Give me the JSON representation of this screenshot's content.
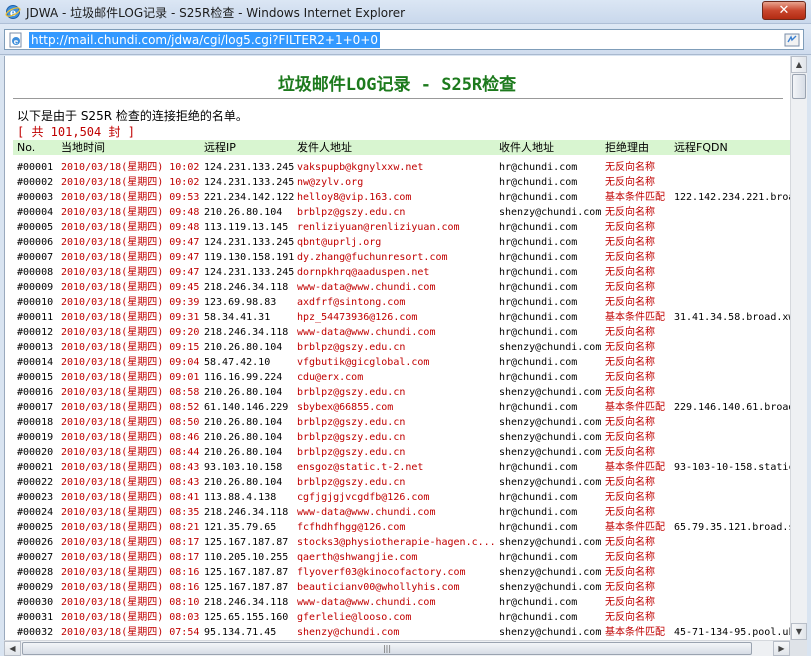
{
  "window": {
    "title": "JDWA - 垃圾邮件LOG记录 - S25R检查 - Windows Internet Explorer",
    "close_label": "✕"
  },
  "address": {
    "url": "http://mail.chundi.com/jdwa/cgi/log5.cgi?FILTER2+1+0+0"
  },
  "page": {
    "title": "垃圾邮件LOG记录 - S25R检查",
    "intro": "以下是由于 S25R 检查的连接拒绝的名单。",
    "total": "[ 共 101,504 封 ]"
  },
  "table": {
    "headers": {
      "no": "No.",
      "time": "当地时间",
      "ip": "远程IP",
      "from": "发件人地址",
      "to": "收件人地址",
      "reason": "拒绝理由",
      "fqdn": "远程FQDN"
    },
    "rows": [
      {
        "no": "#00001",
        "time": "2010/03/18(星期四) 10:02",
        "ip": "124.231.133.245",
        "from": "vakspupb@kgnylxxw.net",
        "to": "hr@chundi.com",
        "reason": "无反向名称",
        "fqdn": ""
      },
      {
        "no": "#00002",
        "time": "2010/03/18(星期四) 10:02",
        "ip": "124.231.133.245",
        "from": "nw@zylv.org",
        "to": "hr@chundi.com",
        "reason": "无反向名称",
        "fqdn": ""
      },
      {
        "no": "#00003",
        "time": "2010/03/18(星期四) 09:53",
        "ip": "221.234.142.122",
        "from": "helloy8@vip.163.com",
        "to": "hr@chundi.com",
        "reason": "基本条件匹配",
        "fqdn": "122.142.234.221.broa"
      },
      {
        "no": "#00004",
        "time": "2010/03/18(星期四) 09:48",
        "ip": "210.26.80.104",
        "from": "brblpz@gszy.edu.cn",
        "to": "shenzy@chundi.com",
        "reason": "无反向名称",
        "fqdn": ""
      },
      {
        "no": "#00005",
        "time": "2010/03/18(星期四) 09:48",
        "ip": "113.119.13.145",
        "from": "renliziyuan@renliziyuan.com",
        "to": "hr@chundi.com",
        "reason": "无反向名称",
        "fqdn": ""
      },
      {
        "no": "#00006",
        "time": "2010/03/18(星期四) 09:47",
        "ip": "124.231.133.245",
        "from": "qbnt@uprlj.org",
        "to": "hr@chundi.com",
        "reason": "无反向名称",
        "fqdn": ""
      },
      {
        "no": "#00007",
        "time": "2010/03/18(星期四) 09:47",
        "ip": "119.130.158.191",
        "from": "dy.zhang@fuchunresort.com",
        "to": "hr@chundi.com",
        "reason": "无反向名称",
        "fqdn": ""
      },
      {
        "no": "#00008",
        "time": "2010/03/18(星期四) 09:47",
        "ip": "124.231.133.245",
        "from": "dornpkhrq@aaduspen.net",
        "to": "hr@chundi.com",
        "reason": "无反向名称",
        "fqdn": ""
      },
      {
        "no": "#00009",
        "time": "2010/03/18(星期四) 09:45",
        "ip": "218.246.34.118",
        "from": "www-data@www.chundi.com",
        "to": "hr@chundi.com",
        "reason": "无反向名称",
        "fqdn": ""
      },
      {
        "no": "#00010",
        "time": "2010/03/18(星期四) 09:39",
        "ip": "123.69.98.83",
        "from": "axdfrf@sintong.com",
        "to": "hr@chundi.com",
        "reason": "无反向名称",
        "fqdn": ""
      },
      {
        "no": "#00011",
        "time": "2010/03/18(星期四) 09:31",
        "ip": "58.34.41.31",
        "from": "hpz_54473936@126.com",
        "to": "hr@chundi.com",
        "reason": "基本条件匹配",
        "fqdn": "31.41.34.58.broad.xw"
      },
      {
        "no": "#00012",
        "time": "2010/03/18(星期四) 09:20",
        "ip": "218.246.34.118",
        "from": "www-data@www.chundi.com",
        "to": "hr@chundi.com",
        "reason": "无反向名称",
        "fqdn": ""
      },
      {
        "no": "#00013",
        "time": "2010/03/18(星期四) 09:15",
        "ip": "210.26.80.104",
        "from": "brblpz@gszy.edu.cn",
        "to": "shenzy@chundi.com",
        "reason": "无反向名称",
        "fqdn": ""
      },
      {
        "no": "#00014",
        "time": "2010/03/18(星期四) 09:04",
        "ip": "58.47.42.10",
        "from": "vfgbutik@gicglobal.com",
        "to": "hr@chundi.com",
        "reason": "无反向名称",
        "fqdn": ""
      },
      {
        "no": "#00015",
        "time": "2010/03/18(星期四) 09:01",
        "ip": "116.16.99.224",
        "from": "cdu@erx.com",
        "to": "hr@chundi.com",
        "reason": "无反向名称",
        "fqdn": ""
      },
      {
        "no": "#00016",
        "time": "2010/03/18(星期四) 08:58",
        "ip": "210.26.80.104",
        "from": "brblpz@gszy.edu.cn",
        "to": "shenzy@chundi.com",
        "reason": "无反向名称",
        "fqdn": ""
      },
      {
        "no": "#00017",
        "time": "2010/03/18(星期四) 08:52",
        "ip": "61.140.146.229",
        "from": "sbybex@66855.com",
        "to": "hr@chundi.com",
        "reason": "基本条件匹配",
        "fqdn": "229.146.140.61.broad"
      },
      {
        "no": "#00018",
        "time": "2010/03/18(星期四) 08:50",
        "ip": "210.26.80.104",
        "from": "brblpz@gszy.edu.cn",
        "to": "shenzy@chundi.com",
        "reason": "无反向名称",
        "fqdn": ""
      },
      {
        "no": "#00019",
        "time": "2010/03/18(星期四) 08:46",
        "ip": "210.26.80.104",
        "from": "brblpz@gszy.edu.cn",
        "to": "shenzy@chundi.com",
        "reason": "无反向名称",
        "fqdn": ""
      },
      {
        "no": "#00020",
        "time": "2010/03/18(星期四) 08:44",
        "ip": "210.26.80.104",
        "from": "brblpz@gszy.edu.cn",
        "to": "shenzy@chundi.com",
        "reason": "无反向名称",
        "fqdn": ""
      },
      {
        "no": "#00021",
        "time": "2010/03/18(星期四) 08:43",
        "ip": "93.103.10.158",
        "from": "ensgoz@static.t-2.net",
        "to": "hr@chundi.com",
        "reason": "基本条件匹配",
        "fqdn": "93-103-10-158.static"
      },
      {
        "no": "#00022",
        "time": "2010/03/18(星期四) 08:43",
        "ip": "210.26.80.104",
        "from": "brblpz@gszy.edu.cn",
        "to": "shenzy@chundi.com",
        "reason": "无反向名称",
        "fqdn": ""
      },
      {
        "no": "#00023",
        "time": "2010/03/18(星期四) 08:41",
        "ip": "113.88.4.138",
        "from": "cgfjgjgjvcgdfb@126.com",
        "to": "hr@chundi.com",
        "reason": "无反向名称",
        "fqdn": ""
      },
      {
        "no": "#00024",
        "time": "2010/03/18(星期四) 08:35",
        "ip": "218.246.34.118",
        "from": "www-data@www.chundi.com",
        "to": "hr@chundi.com",
        "reason": "无反向名称",
        "fqdn": ""
      },
      {
        "no": "#00025",
        "time": "2010/03/18(星期四) 08:21",
        "ip": "121.35.79.65",
        "from": "fcfhdhfhgg@126.com",
        "to": "hr@chundi.com",
        "reason": "基本条件匹配",
        "fqdn": "65.79.35.121.broad.s"
      },
      {
        "no": "#00026",
        "time": "2010/03/18(星期四) 08:17",
        "ip": "125.167.187.87",
        "from": "stocks3@physiotherapie-hagen.c...",
        "to": "shenzy@chundi.com",
        "reason": "无反向名称",
        "fqdn": ""
      },
      {
        "no": "#00027",
        "time": "2010/03/18(星期四) 08:17",
        "ip": "110.205.10.255",
        "from": "qaerth@shwangjie.com",
        "to": "hr@chundi.com",
        "reason": "无反向名称",
        "fqdn": ""
      },
      {
        "no": "#00028",
        "time": "2010/03/18(星期四) 08:16",
        "ip": "125.167.187.87",
        "from": "flyoverf03@kinocofactory.com",
        "to": "shenzy@chundi.com",
        "reason": "无反向名称",
        "fqdn": ""
      },
      {
        "no": "#00029",
        "time": "2010/03/18(星期四) 08:16",
        "ip": "125.167.187.87",
        "from": "beauticianv00@whollyhis.com",
        "to": "shenzy@chundi.com",
        "reason": "无反向名称",
        "fqdn": ""
      },
      {
        "no": "#00030",
        "time": "2010/03/18(星期四) 08:10",
        "ip": "218.246.34.118",
        "from": "www-data@www.chundi.com",
        "to": "hr@chundi.com",
        "reason": "无反向名称",
        "fqdn": ""
      },
      {
        "no": "#00031",
        "time": "2010/03/18(星期四) 08:03",
        "ip": "125.65.155.160",
        "from": "gferlelie@looso.com",
        "to": "hr@chundi.com",
        "reason": "无反向名称",
        "fqdn": ""
      },
      {
        "no": "#00032",
        "time": "2010/03/18(星期四) 07:54",
        "ip": "95.134.71.45",
        "from": "shenzy@chundi.com",
        "to": "shenzy@chundi.com",
        "reason": "基本条件匹配",
        "fqdn": "45-71-134-95.pool.uk"
      }
    ]
  },
  "scrollbars": {
    "up_arrow": "▲",
    "down_arrow": "▼",
    "left_arrow": "◀",
    "right_arrow": "▶",
    "grip": "|||"
  },
  "icons": {
    "app": "ie-logo-icon",
    "address": "ie-page-icon",
    "compat": "compatibility-view-icon"
  }
}
